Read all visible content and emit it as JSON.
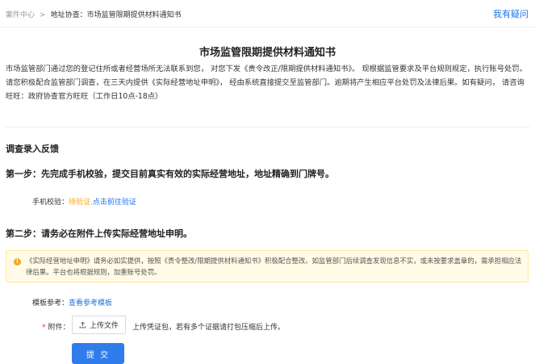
{
  "breadcrumb": {
    "root": "案件中心",
    "separator": ">",
    "current": "地址协查：市场监管限期提供材料通知书"
  },
  "help_link": "我有疑问",
  "page_title": "市场监管限期提供材料通知书",
  "intro": "市场监管部门通过您的登记住所或者经营场所无法联系到您， 对您下发《责令改正/限期提供材料通知书》。 现根据监管要求及平台规则规定，执行账号处罚。请您积极配合监管部门调查，在三天内提供《实际经营地址申明》， 经由系统直接提交至监管部门。逾期将产生相应平台处罚及法律后果。如有疑问， 请咨询旺旺：政府协查官方旺旺（工作日10点-18点）",
  "section_heading": "调查录入反馈",
  "step1": {
    "title": "第一步：先完成手机校验，提交目前真实有效的实际经营地址，地址精确到门牌号。",
    "phone_label": "手机校验：",
    "phone_status": "待验证,",
    "phone_link": "点击前往验证"
  },
  "step2": {
    "title": "第二步：请务必在附件上传实际经营地址申明。",
    "notice": "《实际经营地址申明》请务必如实提供，按照《责令整改/限期提供材料通知书》积极配合整改。如监管部门后续调查发现信息不实，或未按要求盖章的，需承担相应法律后果。平台也将根据规则，加重账号处罚。",
    "template_label": "模板参考：",
    "template_link": "查看参考模板",
    "attachment_required_mark": "*",
    "attachment_label": "附件：",
    "upload_button": "上传文件",
    "upload_hint": "上传凭证包，若有多个证据请打包压缩后上传。"
  },
  "submit_button": "提 交",
  "colors": {
    "accent": "#1a74e8",
    "warning": "#f5a623",
    "notice_bg": "#fffbe6",
    "submit_bg": "#2f7dea"
  },
  "icons": {
    "notice": "warning-icon",
    "upload": "upload-icon"
  }
}
